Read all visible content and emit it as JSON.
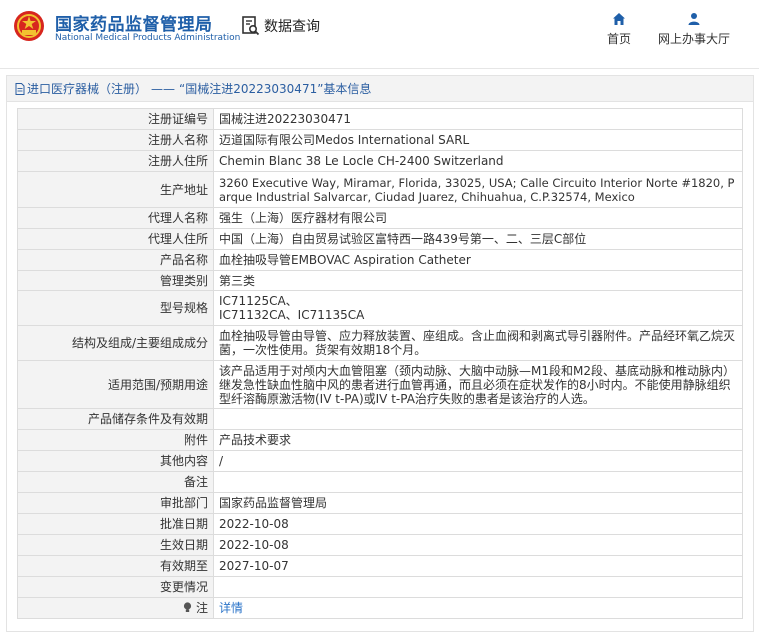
{
  "header": {
    "site_name_cn": "国家药品监督管理局",
    "site_name_en": "National Medical Products Administration",
    "data_query": "数据查询",
    "nav_home": "首页",
    "nav_office": "网上办事大厅"
  },
  "breadcrumb": {
    "category": "进口医疗器械（注册）",
    "separator": "——",
    "title": "“国械注进20223030471”基本信息"
  },
  "rows": [
    {
      "label": "注册证编号",
      "value": "国械注进20223030471"
    },
    {
      "label": "注册人名称",
      "value": "迈道国际有限公司Medos International SARL"
    },
    {
      "label": "注册人住所",
      "value": "Chemin Blanc 38 Le Locle CH-2400 Switzerland"
    },
    {
      "label": "生产地址",
      "value": "3260 Executive Way, Miramar, Florida, 33025, USA; Calle Circuito Interior Norte #1820, Parque Industrial Salvarcar, Ciudad Juarez, Chihuahua, C.P.32574, Mexico"
    },
    {
      "label": "代理人名称",
      "value": "强生（上海）医疗器材有限公司"
    },
    {
      "label": "代理人住所",
      "value": "中国（上海）自由贸易试验区富特西一路439号第一、二、三层C部位"
    },
    {
      "label": "产品名称",
      "value": "血栓抽吸导管EMBOVAC Aspiration Catheter"
    },
    {
      "label": "管理类别",
      "value": "第三类"
    },
    {
      "label": "型号规格",
      "value_lines": [
        "IC71125CA、",
        "IC71132CA、IC71135CA"
      ]
    },
    {
      "label": "结构及组成/主要组成成分",
      "value": "血栓抽吸导管由导管、应力释放装置、座组成。含止血阀和剥离式导引器附件。产品经环氧乙烷灭菌，一次性使用。货架有效期18个月。"
    },
    {
      "label": "适用范围/预期用途",
      "value": "该产品适用于对颅内大血管阻塞（颈内动脉、大脑中动脉—M1段和M2段、基底动脉和椎动脉内）继发急性缺血性脑中风的患者进行血管再通，而且必须在症状发作的8小时内。不能使用静脉组织型纤溶酶原激活物(IV t-PA)或IV t-PA治疗失败的患者是该治疗的人选。"
    },
    {
      "label": "产品储存条件及有效期",
      "value": ""
    },
    {
      "label": "附件",
      "value": "产品技术要求"
    },
    {
      "label": "其他内容",
      "value": "/"
    },
    {
      "label": "备注",
      "value": ""
    },
    {
      "label": "审批部门",
      "value": "国家药品监督管理局"
    },
    {
      "label": "批准日期",
      "value": "2022-10-08"
    },
    {
      "label": "生效日期",
      "value": "2022-10-08"
    },
    {
      "label": "有效期至",
      "value": "2027-10-07"
    },
    {
      "label": "变更情况",
      "value": ""
    },
    {
      "label": "注",
      "value": "详情"
    }
  ]
}
